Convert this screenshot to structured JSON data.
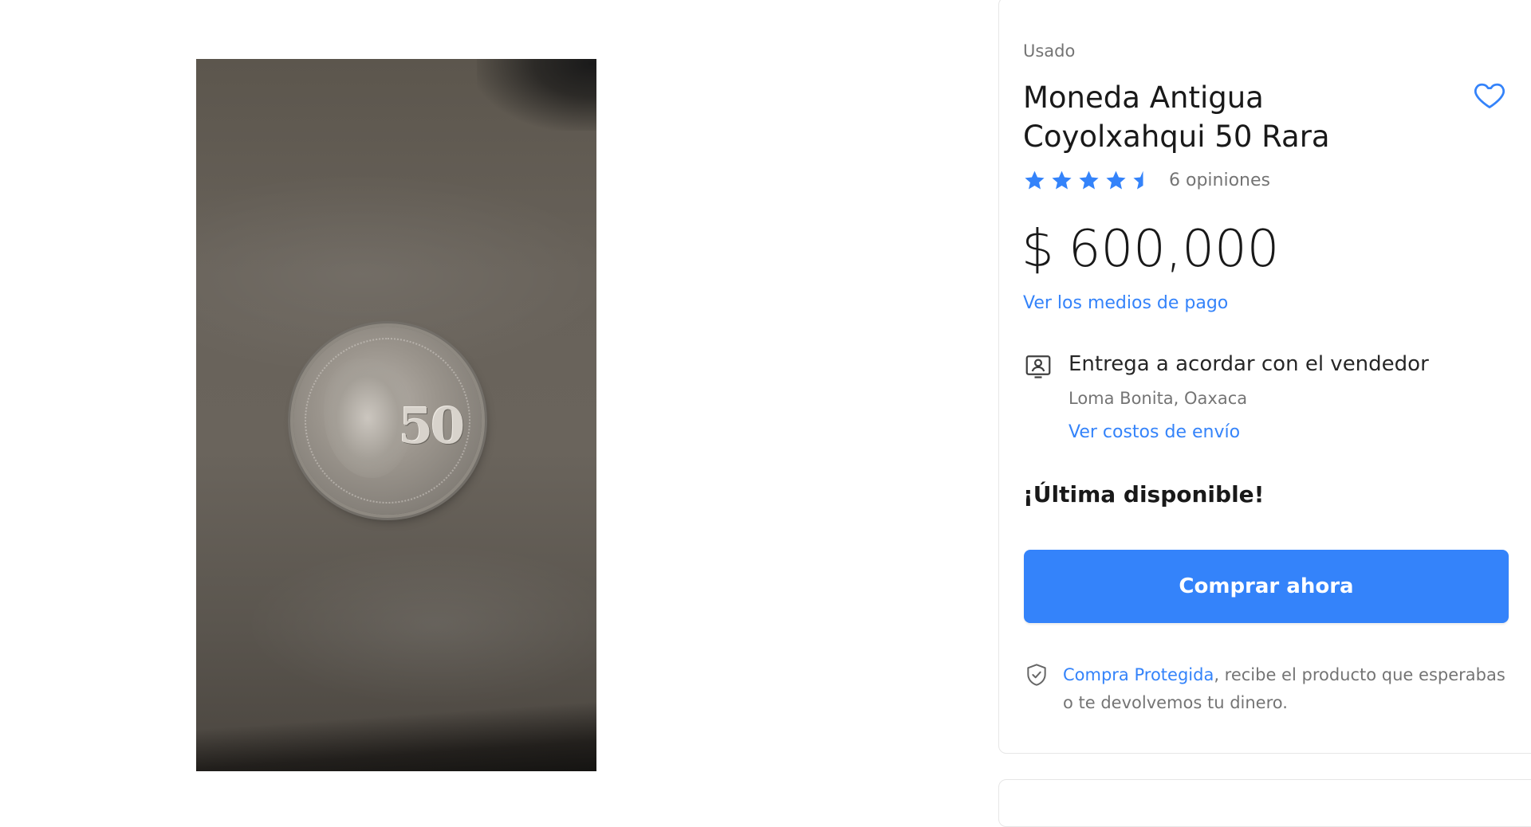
{
  "product": {
    "condition": "Usado",
    "title": "Moneda Antigua Coyolxahqui 50 Rara",
    "rating": {
      "value": 4.5,
      "max": 5,
      "reviews_label": "6 opiniones"
    },
    "price": {
      "currency": "$",
      "amount": "600,000"
    },
    "payment_link": "Ver los medios de pago",
    "shipping": {
      "title": "Entrega a acordar con el vendedor",
      "location": "Loma Bonita, Oaxaca",
      "costs_link": "Ver costos de envío"
    },
    "stock_label": "¡Última disponible!",
    "buy_button": "Comprar ahora",
    "protection": {
      "link": "Compra Protegida",
      "text": ", recibe el producto que esperabas o te devolvemos tu dinero."
    }
  },
  "image": {
    "coin_denomination": "50"
  },
  "icons": {
    "favorite": "heart-outline-icon",
    "star": "star-icon",
    "shipping": "person-card-icon",
    "protection": "shield-check-icon"
  },
  "colors": {
    "accent": "#3483fa",
    "star": "#3483fa",
    "text_primary": "rgba(0,0,0,0.9)",
    "text_secondary": "rgba(0,0,0,0.55)"
  }
}
